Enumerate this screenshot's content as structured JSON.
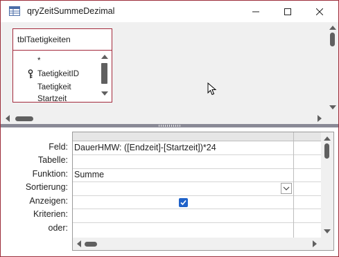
{
  "window": {
    "title": "qryZeitSummeDezimal",
    "accent_color": "#9b2d3a"
  },
  "table_box": {
    "title": "tblTaetigkeiten",
    "fields": [
      {
        "label": "*",
        "primary_key": false
      },
      {
        "label": "TaetigkeitID",
        "primary_key": true
      },
      {
        "label": "Taetigkeit",
        "primary_key": false
      },
      {
        "label": "Startzeit",
        "primary_key": false
      }
    ]
  },
  "grid": {
    "row_labels": [
      "Feld:",
      "Tabelle:",
      "Funktion:",
      "Sortierung:",
      "Anzeigen:",
      "Kriterien:",
      "oder:"
    ],
    "column": {
      "feld": "DauerHMW: ([Endzeit]-[Startzeit])*24",
      "tabelle": "",
      "funktion": "Summe",
      "sortierung": "",
      "anzeigen": true,
      "kriterien": "",
      "oder": ""
    },
    "checkbox_color": "#1f62c9"
  },
  "icons": {
    "app": "query-icon",
    "minimize": "minimize-icon",
    "maximize": "maximize-icon",
    "close": "close-icon",
    "key": "primary-key-icon",
    "cursor": "mouse-pointer-icon"
  }
}
